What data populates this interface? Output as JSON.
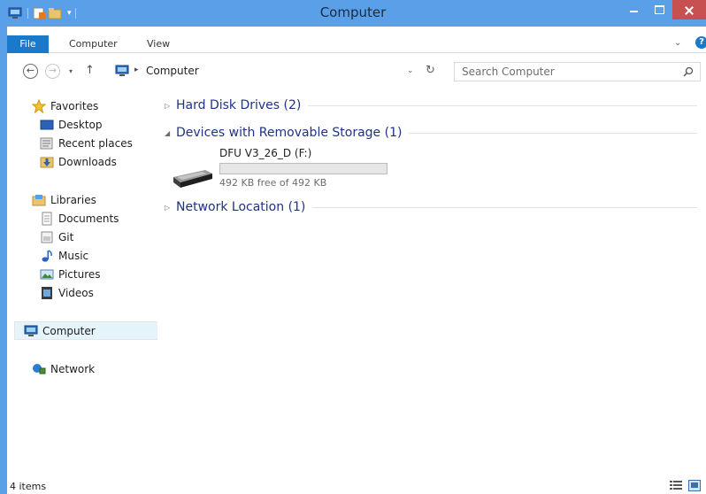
{
  "window": {
    "title": "Computer",
    "frame_color": "#5aa0e8",
    "close_color": "#c75050"
  },
  "quick_access": {
    "icons": [
      "computer-icon",
      "properties-icon",
      "new-folder-icon"
    ],
    "dropdown": "▾"
  },
  "ribbon": {
    "tabs": [
      {
        "label": "File",
        "active": true
      },
      {
        "label": "Computer"
      },
      {
        "label": "View"
      }
    ],
    "expand_glyph": "⌄",
    "help_glyph": "?",
    "accent": "#1979ca"
  },
  "navigation": {
    "back_glyph": "←",
    "forward_glyph": "→",
    "recent_glyph": "▾",
    "up_glyph": "↑",
    "address": {
      "separator": "▸",
      "location": "Computer",
      "dropdown_glyph": "⌄",
      "refresh_glyph": "↻"
    },
    "search": {
      "placeholder": "Search Computer"
    }
  },
  "nav_pane": {
    "favorites": {
      "label": "Favorites",
      "items": [
        "Desktop",
        "Recent places",
        "Downloads"
      ]
    },
    "libraries": {
      "label": "Libraries",
      "items": [
        "Documents",
        "Git",
        "Music",
        "Pictures",
        "Videos"
      ]
    },
    "computer": {
      "label": "Computer",
      "selected": true
    },
    "network": {
      "label": "Network"
    }
  },
  "content": {
    "groups": [
      {
        "title": "Hard Disk Drives (2)",
        "expanded": false,
        "arrow": "▷"
      },
      {
        "title": "Devices with Removable Storage (1)",
        "expanded": true,
        "arrow": "◢"
      },
      {
        "title": "Network Location (1)",
        "expanded": false,
        "arrow": "▷"
      }
    ],
    "drive": {
      "name": "DFU V3_26_D (F:)",
      "free_text": "492 KB free of 492 KB",
      "used_fraction": 0.0
    }
  },
  "status": {
    "count": "4 items",
    "views": [
      "details-view-icon",
      "large-icons-view-icon"
    ]
  }
}
